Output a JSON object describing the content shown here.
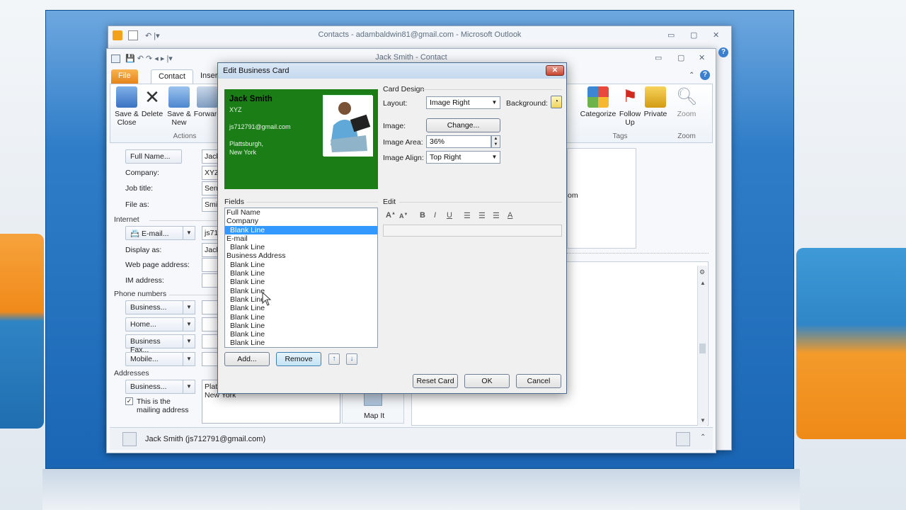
{
  "outer_window": {
    "title": "Contacts - adambaldwin81@gmail.com - Microsoft Outlook"
  },
  "contact_window": {
    "title": "Jack Smith - Contact"
  },
  "ribbon": {
    "tabs": [
      "File",
      "Contact",
      "Insert"
    ],
    "save_close": "Save &\nClose",
    "delete": "Delete",
    "save_new": "Save &\nNew",
    "forward": "Forward",
    "actions_group": "Actions",
    "categorize": "Categorize",
    "follow_up": "Follow\nUp",
    "private": "Private",
    "tags_group": "Tags",
    "zoom": "Zoom",
    "zoom_group": "Zoom"
  },
  "form": {
    "full_name_btn": "Full Name...",
    "full_name_val": "Jack",
    "company_lbl": "Company:",
    "company_val": "XYZ",
    "job_title_lbl": "Job title:",
    "job_title_val": "Seni",
    "file_as_lbl": "File as:",
    "file_as_val": "Smit",
    "internet_sect": "Internet",
    "email_btn": "E-mail...",
    "email_val": "js71",
    "display_as_lbl": "Display as:",
    "display_as_val": "Jack",
    "web_lbl": "Web page address:",
    "im_lbl": "IM address:",
    "phone_sect": "Phone numbers",
    "business_btn": "Business...",
    "home_btn": "Home...",
    "biz_fax_btn": "Business Fax...",
    "mobile_btn": "Mobile...",
    "addresses_sect": "Addresses",
    "addr_business_btn": "Business...",
    "mailing_chk": "This is the mailing address",
    "address_val1": "Platt",
    "address_val2": "New York",
    "map_it": "Map It",
    "right_partial": "om"
  },
  "status": {
    "person": "Jack Smith (js712791@gmail.com)"
  },
  "dialog": {
    "title": "Edit Business Card",
    "close": "✕",
    "card": {
      "name": "Jack Smith",
      "company": "XYZ",
      "email": "js712791@gmail.com",
      "city": "Plattsburgh,",
      "state": "New York"
    },
    "card_design": "Card Design",
    "layout_lbl": "Layout:",
    "layout_val": "Image Right",
    "background_lbl": "Background:",
    "image_lbl": "Image:",
    "change_btn": "Change...",
    "image_area_lbl": "Image Area:",
    "image_area_val": "36%",
    "image_align_lbl": "Image Align:",
    "image_align_val": "Top Right",
    "fields_lbl": "Fields",
    "edit_lbl": "Edit",
    "fields": [
      {
        "label": "Full Name",
        "indent": false,
        "selected": false
      },
      {
        "label": "Company",
        "indent": false,
        "selected": false
      },
      {
        "label": "Blank Line",
        "indent": true,
        "selected": true
      },
      {
        "label": "E-mail",
        "indent": false,
        "selected": false
      },
      {
        "label": "Blank Line",
        "indent": true,
        "selected": false
      },
      {
        "label": "Business Address",
        "indent": false,
        "selected": false
      },
      {
        "label": "Blank Line",
        "indent": true,
        "selected": false
      },
      {
        "label": "Blank Line",
        "indent": true,
        "selected": false
      },
      {
        "label": "Blank Line",
        "indent": true,
        "selected": false
      },
      {
        "label": "Blank Line",
        "indent": true,
        "selected": false
      },
      {
        "label": "Blank Line",
        "indent": true,
        "selected": false
      },
      {
        "label": "Blank Line",
        "indent": true,
        "selected": false
      },
      {
        "label": "Blank Line",
        "indent": true,
        "selected": false
      },
      {
        "label": "Blank Line",
        "indent": true,
        "selected": false
      },
      {
        "label": "Blank Line",
        "indent": true,
        "selected": false
      },
      {
        "label": "Blank Line",
        "indent": true,
        "selected": false
      }
    ],
    "add_btn": "Add...",
    "remove_btn": "Remove",
    "reset_btn": "Reset Card",
    "ok_btn": "OK",
    "cancel_btn": "Cancel",
    "card_bg_color": "#1a7d16"
  }
}
